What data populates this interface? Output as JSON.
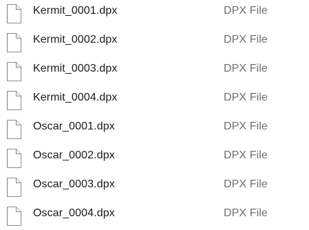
{
  "files": [
    {
      "name": "Kermit_0001.dpx",
      "type": "DPX File",
      "icon": "blank-file-icon"
    },
    {
      "name": "Kermit_0002.dpx",
      "type": "DPX File",
      "icon": "blank-file-icon"
    },
    {
      "name": "Kermit_0003.dpx",
      "type": "DPX File",
      "icon": "blank-file-icon"
    },
    {
      "name": "Kermit_0004.dpx",
      "type": "DPX File",
      "icon": "blank-file-icon"
    },
    {
      "name": "Oscar_0001.dpx",
      "type": "DPX File",
      "icon": "blank-file-icon"
    },
    {
      "name": "Oscar_0002.dpx",
      "type": "DPX File",
      "icon": "blank-file-icon"
    },
    {
      "name": "Oscar_0003.dpx",
      "type": "DPX File",
      "icon": "blank-file-icon"
    },
    {
      "name": "Oscar_0004.dpx",
      "type": "DPX File",
      "icon": "blank-file-icon"
    }
  ],
  "colors": {
    "name_text": "#1a1a1a",
    "type_text": "#6d6d6d",
    "icon_border": "#8a8a8a",
    "icon_fill": "#ffffff"
  }
}
